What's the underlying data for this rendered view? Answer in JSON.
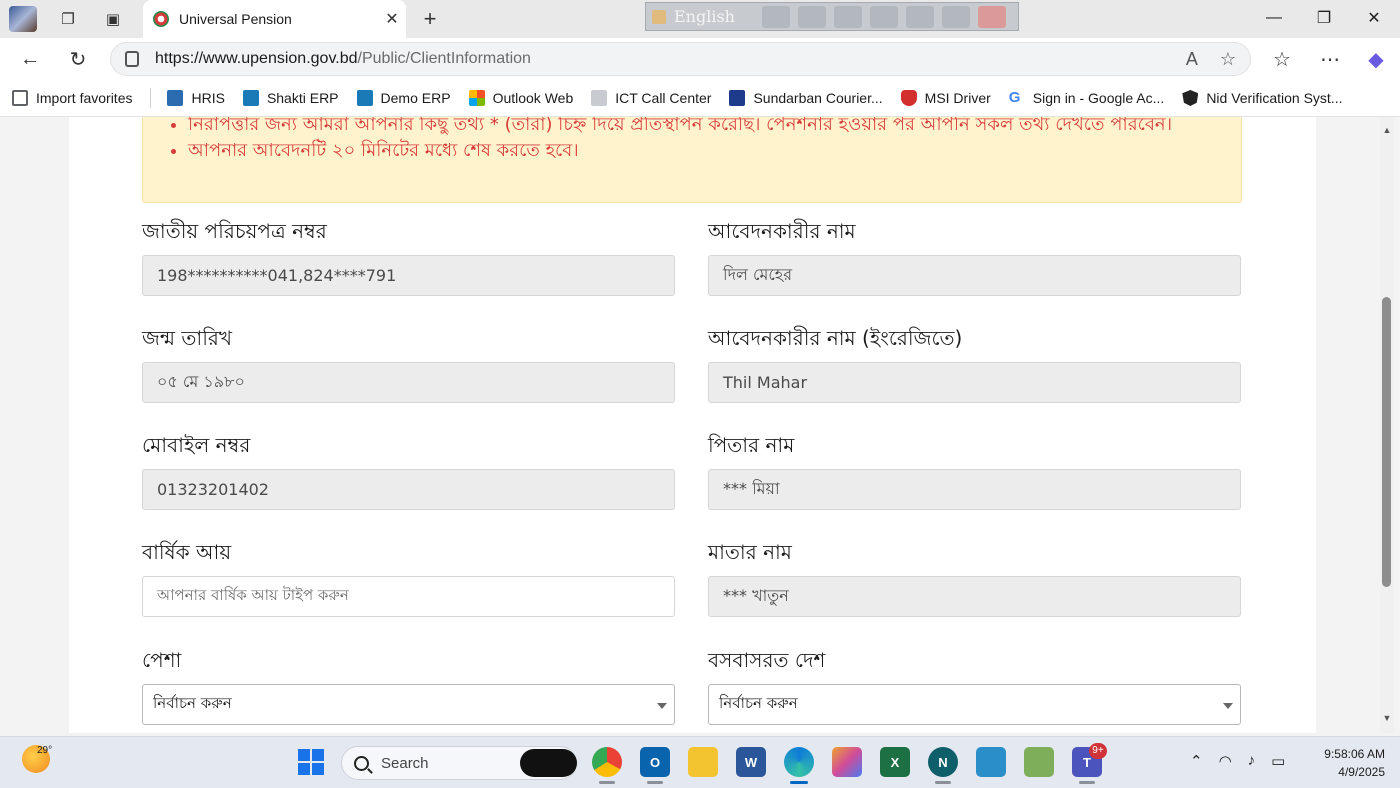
{
  "tab": {
    "title": "Universal Pension",
    "close": "✕",
    "new": "+"
  },
  "ime": {
    "language": "English"
  },
  "window": {
    "minimize": "—",
    "restore": "❐",
    "close": "✕"
  },
  "address": {
    "host": "https://www.upension.gov.bd",
    "path": "/Public/ClientInformation"
  },
  "favorites": [
    {
      "label": "Import favorites",
      "color": "#5f6368"
    },
    {
      "label": "HRIS",
      "color": "#2b6cb0"
    },
    {
      "label": "Shakti ERP",
      "color": "#1a7ab8"
    },
    {
      "label": "Demo ERP",
      "color": "#1a7ab8"
    },
    {
      "label": "Outlook Web",
      "color": "#f25022"
    },
    {
      "label": "ICT Call Center",
      "color": "#9aa0a6"
    },
    {
      "label": "Sundarban Courier...",
      "color": "#1e3a8a"
    },
    {
      "label": "MSI Driver",
      "color": "#d32f2f"
    },
    {
      "label": "Sign in - Google Ac...",
      "color": "#4285f4"
    },
    {
      "label": "Nid Verification Syst...",
      "color": "#222222"
    }
  ],
  "notice": {
    "items": [
      "নিরাপত্তার জন্য আমরা আপনার কিছু তথ্য * (তারা) চিহ্ন দিয়ে প্রতিস্থাপন করেছি। পেনশনার হওয়ার পর আপনি সকল তথ্য দেখতে পারবেন।",
      "আপনার আবেদনটি ২০ মিনিটের মধ্যে শেষ করতে হবে।"
    ]
  },
  "form": {
    "nid": {
      "label": "জাতীয় পরিচয়পত্র নম্বর",
      "value": "198**********041,824****791"
    },
    "name_bn": {
      "label": "আবেদনকারীর নাম",
      "value": "দিল মেহের"
    },
    "dob": {
      "label": "জন্ম তারিখ",
      "value": "০৫ মে ১৯৮০"
    },
    "name_en": {
      "label": "আবেদনকারীর নাম (ইংরেজিতে)",
      "value": "Thil Mahar"
    },
    "mobile": {
      "label": "মোবাইল নম্বর",
      "value": "01323201402"
    },
    "father": {
      "label": "পিতার নাম",
      "value": "*** মিয়া"
    },
    "income": {
      "label": "বার্ষিক আয়",
      "placeholder": "আপনার বার্ষিক আয় টাইপ করুন"
    },
    "mother": {
      "label": "মাতার নাম",
      "value": "*** খাতুন"
    },
    "profession": {
      "label": "পেশা",
      "selected": "নির্বাচন করুন"
    },
    "country": {
      "label": "বসবাসরত দেশ",
      "selected": "নির্বাচন করুন"
    }
  },
  "taskbar": {
    "temperature": "29°",
    "search_label": "Search",
    "notification_count": "9+",
    "time": "9:58:06 AM",
    "date": "4/9/2025"
  }
}
